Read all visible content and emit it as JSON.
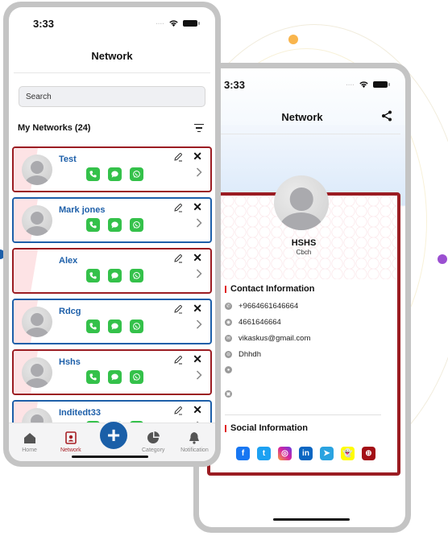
{
  "colors": {
    "brand_red": "#9b1c22",
    "brand_blue": "#1d5fa9",
    "action_green": "#34c14a",
    "dot_orange": "#f9b54c",
    "dot_purple": "#9b4fd1"
  },
  "left_phone": {
    "status_time": "3:33",
    "title": "Network",
    "search": {
      "placeholder": "Search",
      "value": ""
    },
    "list_header": "My Networks (24)",
    "contacts": [
      {
        "name": "Test",
        "border": "red",
        "has_avatar": true
      },
      {
        "name": "Mark jones",
        "border": "blue",
        "has_avatar": true
      },
      {
        "name": "Alex",
        "border": "red",
        "has_avatar": false
      },
      {
        "name": "Rdcg",
        "border": "blue",
        "has_avatar": true
      },
      {
        "name": "Hshs",
        "border": "red",
        "has_avatar": true
      },
      {
        "name": "Inditedt33",
        "border": "blue",
        "has_avatar": true
      }
    ],
    "contact_actions": [
      "phone-icon",
      "message-icon",
      "whatsapp-icon"
    ],
    "tabs": [
      {
        "label": "Home",
        "icon": "home-icon",
        "active": false
      },
      {
        "label": "Network",
        "icon": "network-icon",
        "active": true
      },
      {
        "label": "",
        "icon": "plus-icon",
        "active": false
      },
      {
        "label": "Category",
        "icon": "pie-chart-icon",
        "active": false
      },
      {
        "label": "Notification",
        "icon": "bell-icon",
        "active": false
      }
    ],
    "fab_label": "+"
  },
  "right_phone": {
    "status_time": "3:33",
    "title": "Network",
    "profile": {
      "name": "HSHS",
      "subtitle": "Cbch"
    },
    "contact_section_title": "Contact Information",
    "contact_info": [
      {
        "icon": "phone-icon",
        "value": "+9664661646664"
      },
      {
        "icon": "whatsapp-icon",
        "value": "4661646664"
      },
      {
        "icon": "email-icon",
        "value": "vikaskus@gmail.com"
      },
      {
        "icon": "globe-icon",
        "value": "Dhhdh"
      },
      {
        "icon": "location-icon",
        "value": ""
      },
      {
        "icon": "calendar-icon",
        "value": ""
      }
    ],
    "social_section_title": "Social Information",
    "socials": [
      {
        "name": "facebook",
        "glyph": "f",
        "color": "#1877f2"
      },
      {
        "name": "twitter",
        "glyph": "t",
        "color": "#1da1f2"
      },
      {
        "name": "instagram",
        "glyph": "◎",
        "color": "#d6249f"
      },
      {
        "name": "linkedin",
        "glyph": "in",
        "color": "#0a66c2"
      },
      {
        "name": "telegram",
        "glyph": "➤",
        "color": "#2aa3e0"
      },
      {
        "name": "snapchat",
        "glyph": "👻",
        "color": "#fffc00"
      },
      {
        "name": "website",
        "glyph": "⊕",
        "color": "#a30f16"
      }
    ]
  }
}
